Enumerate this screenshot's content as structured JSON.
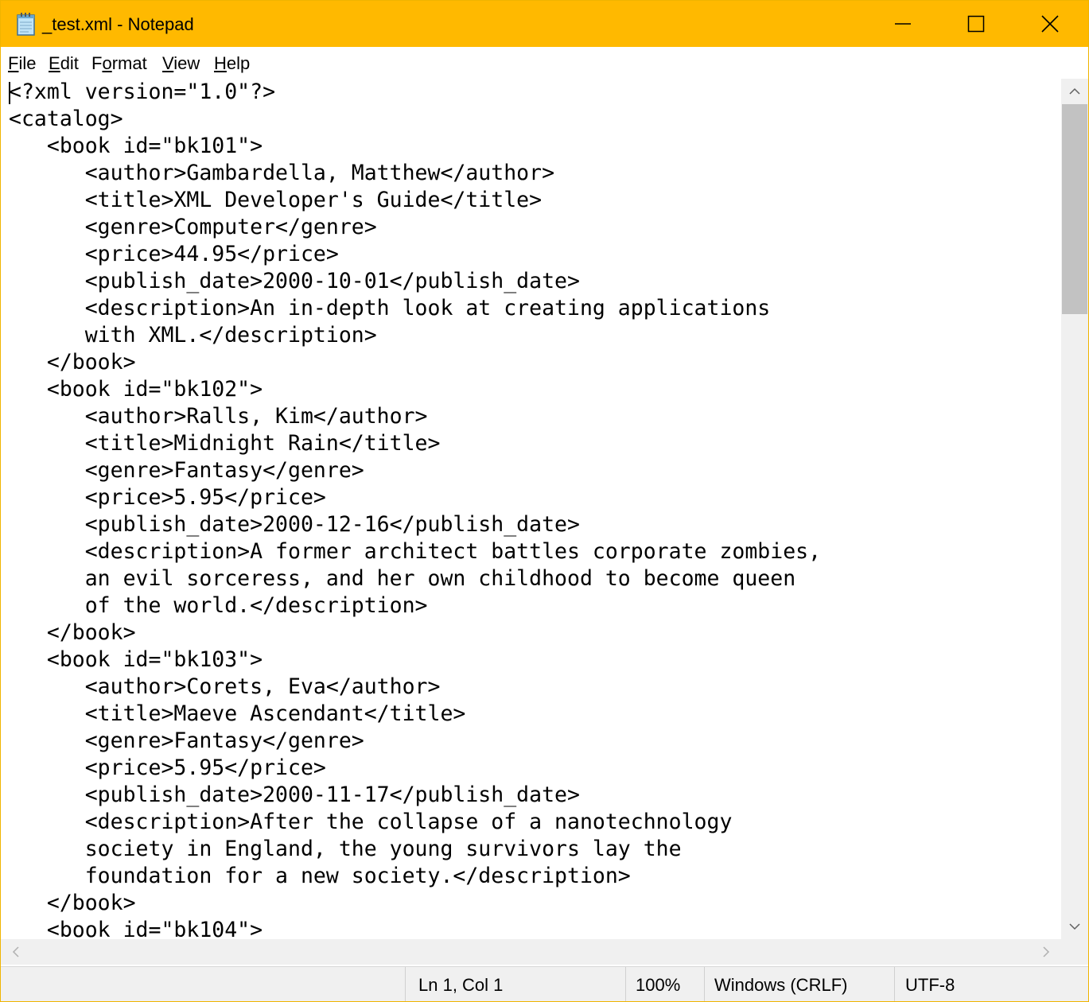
{
  "window": {
    "title": "_test.xml - Notepad",
    "accent_color": "#ffb900",
    "controls": [
      "minimize-icon",
      "maximize-icon",
      "close-icon"
    ]
  },
  "menu": [
    {
      "label": "File",
      "mnemonic": "F",
      "rest": "ile"
    },
    {
      "label": "Edit",
      "mnemonic": "E",
      "rest": "dit"
    },
    {
      "label": "Format",
      "mnemonic": "o",
      "pre": "F",
      "rest": "rmat"
    },
    {
      "label": "View",
      "mnemonic": "V",
      "rest": "iew"
    },
    {
      "label": "Help",
      "mnemonic": "H",
      "rest": "elp"
    }
  ],
  "editor": {
    "lines": [
      "<?xml version=\"1.0\"?>",
      "<catalog>",
      "   <book id=\"bk101\">",
      "      <author>Gambardella, Matthew</author>",
      "      <title>XML Developer's Guide</title>",
      "      <genre>Computer</genre>",
      "      <price>44.95</price>",
      "      <publish_date>2000-10-01</publish_date>",
      "      <description>An in-depth look at creating applications",
      "      with XML.</description>",
      "   </book>",
      "   <book id=\"bk102\">",
      "      <author>Ralls, Kim</author>",
      "      <title>Midnight Rain</title>",
      "      <genre>Fantasy</genre>",
      "      <price>5.95</price>",
      "      <publish_date>2000-12-16</publish_date>",
      "      <description>A former architect battles corporate zombies,",
      "      an evil sorceress, and her own childhood to become queen",
      "      of the world.</description>",
      "   </book>",
      "   <book id=\"bk103\">",
      "      <author>Corets, Eva</author>",
      "      <title>Maeve Ascendant</title>",
      "      <genre>Fantasy</genre>",
      "      <price>5.95</price>",
      "      <publish_date>2000-11-17</publish_date>",
      "      <description>After the collapse of a nanotechnology",
      "      society in England, the young survivors lay the",
      "      foundation for a new society.</description>",
      "   </book>",
      "   <book id=\"bk104\">"
    ]
  },
  "statusbar": {
    "position": "Ln 1, Col 1",
    "zoom": "100%",
    "line_ending": "Windows (CRLF)",
    "encoding": "UTF-8"
  }
}
